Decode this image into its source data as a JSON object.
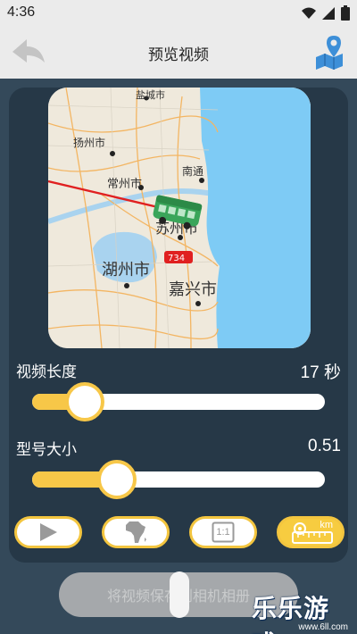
{
  "status_bar": {
    "time": "4:36",
    "icons": [
      "wifi-icon",
      "signal-icon",
      "battery-icon"
    ]
  },
  "app_bar": {
    "title": "预览视频",
    "back_icon": "back-arrow-icon",
    "right_icon": "map-pin-icon"
  },
  "map": {
    "city_labels": [
      "盐城市",
      "扬州市",
      "常州市",
      "南通",
      "苏州市",
      "湖州市",
      "嘉兴市"
    ],
    "road_badge": "734",
    "route_color": "#e02020",
    "water_color": "#7ecbf5",
    "vehicle_icon": "bus-icon"
  },
  "video_length": {
    "label": "视频长度",
    "value": "17 秒",
    "level": 0.18
  },
  "model_size": {
    "label": "型号大小",
    "value": "0.51",
    "level": 0.29
  },
  "modes": [
    {
      "name": "play",
      "icon": "play-icon",
      "active": false
    },
    {
      "name": "map-style",
      "icon": "africa-map-icon",
      "active": false
    },
    {
      "name": "aspect",
      "icon": "aspect-ratio-icon",
      "label": "1:1",
      "active": false
    },
    {
      "name": "scale",
      "icon": "km-ruler-icon",
      "label": "km",
      "active": true
    }
  ],
  "save_button": {
    "label": "将视频保存到相机相册"
  },
  "watermark": {
    "text": "乐乐游戏",
    "url": "www.6ll.com"
  },
  "colors": {
    "accent": "#f7c748",
    "panel": "#263847",
    "background": "#34495a"
  }
}
